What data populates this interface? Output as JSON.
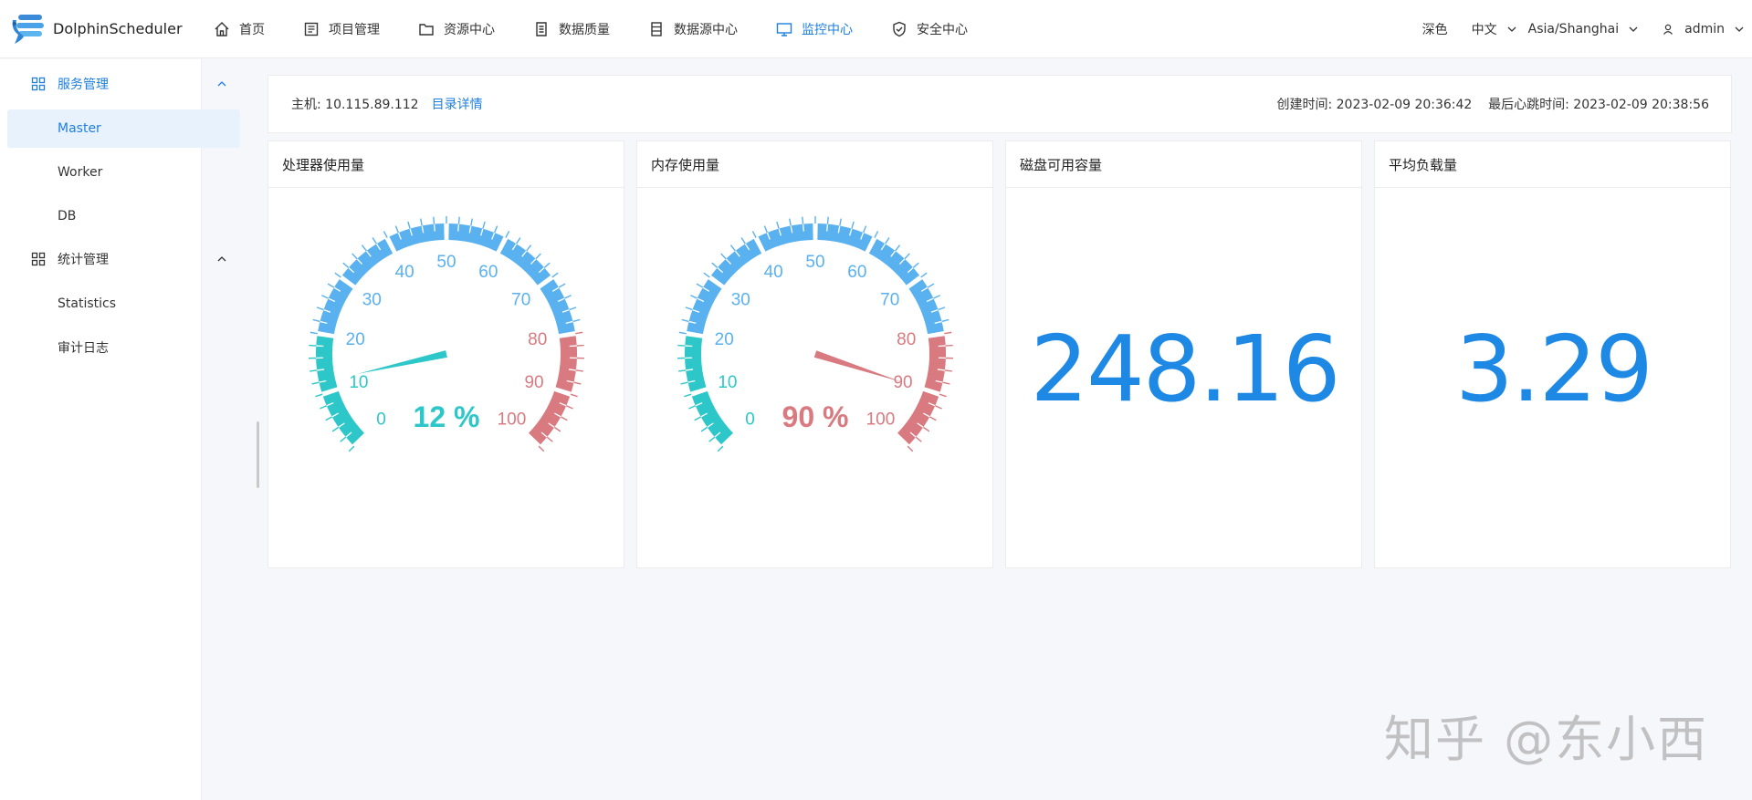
{
  "header": {
    "brand": "DolphinScheduler",
    "nav": [
      {
        "label": "首页",
        "icon": "home-icon"
      },
      {
        "label": "项目管理",
        "icon": "project-icon"
      },
      {
        "label": "资源中心",
        "icon": "folder-icon"
      },
      {
        "label": "数据质量",
        "icon": "document-icon"
      },
      {
        "label": "数据源中心",
        "icon": "database-icon"
      },
      {
        "label": "监控中心",
        "icon": "monitor-icon",
        "active": true
      },
      {
        "label": "安全中心",
        "icon": "shield-icon"
      }
    ],
    "theme_label": "深色",
    "language": "中文",
    "timezone": "Asia/Shanghai",
    "user": "admin"
  },
  "sidebar": {
    "groups": [
      {
        "label": "服务管理",
        "icon": "grid-icon",
        "active": true,
        "items": [
          {
            "label": "Master",
            "active": true
          },
          {
            "label": "Worker"
          },
          {
            "label": "DB"
          }
        ]
      },
      {
        "label": "统计管理",
        "icon": "grid-icon",
        "items": [
          {
            "label": "Statistics"
          },
          {
            "label": "审计日志"
          }
        ]
      }
    ]
  },
  "host": {
    "label": "主机: 10.115.89.112",
    "link": "目录详情",
    "meta": "创建时间: 2023-02-09 20:36:42    最后心跳时间: 2023-02-09 20:38:56"
  },
  "cards": [
    {
      "title": "处理器使用量",
      "kind": "gauge",
      "value": 12,
      "value_label": "12 %"
    },
    {
      "title": "内存使用量",
      "kind": "gauge",
      "value": 90,
      "value_label": "90 %"
    },
    {
      "title": "磁盘可用容量",
      "kind": "number",
      "value_label": "248.16"
    },
    {
      "title": "平均负载量",
      "kind": "number",
      "value_label": "3.29"
    }
  ],
  "gauge_ticks": [
    "0",
    "10",
    "20",
    "30",
    "40",
    "50",
    "60",
    "70",
    "80",
    "90",
    "100"
  ],
  "colors": {
    "low": "#2ec7c9",
    "mid": "#5ab1ef",
    "high": "#d87a80",
    "accent": "#1e7fe0",
    "number": "#1e88e5"
  },
  "watermark": "知乎 @东小西"
}
